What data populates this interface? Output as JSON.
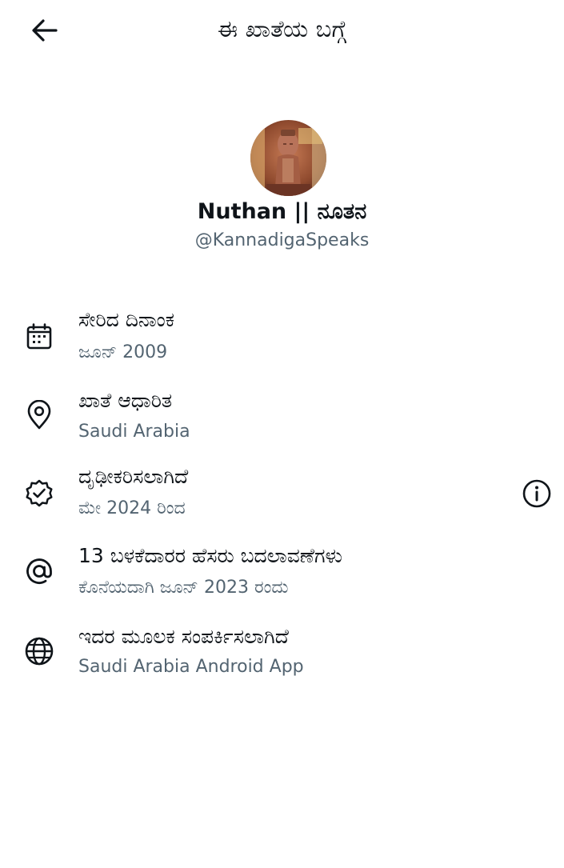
{
  "header": {
    "back_icon": "arrow-left-icon",
    "title": "ಈ ಖಾತೆಯ ಬಗ್ಗೆ"
  },
  "profile": {
    "avatar_icon": "avatar",
    "display_name": "Nuthan || ನೂತನ",
    "handle": "@KannadigaSpeaks"
  },
  "rows": [
    {
      "icon": "calendar-icon",
      "title": "ಸೇರಿದ ದಿನಾಂಕ",
      "subtitle": "ಜೂನ್ 2009"
    },
    {
      "icon": "location-pin-icon",
      "title": "ಖಾತೆ ಆಧಾರಿತ",
      "subtitle": "Saudi Arabia"
    },
    {
      "icon": "verified-badge-icon",
      "title": "ದೃಢೀಕರಿಸಲಾಗಿದೆ",
      "subtitle": "ಮೇ 2024 ರಿಂದ",
      "action_icon": "info-icon"
    },
    {
      "icon": "at-sign-icon",
      "title": "13 ಬಳಕೆದಾರರ ಹೆಸರು ಬದಲಾವಣೆಗಳು",
      "subtitle": "ಕೊನೆಯದಾಗಿ ಜೂನ್ 2023 ರಂದು"
    },
    {
      "icon": "globe-icon",
      "title": "ಇದರ ಮೂಲಕ ಸಂಪರ್ಕಿಸಲಾಗಿದೆ",
      "subtitle": "Saudi Arabia Android App"
    }
  ],
  "colors": {
    "text_primary": "#0f1419",
    "text_secondary": "#536471",
    "icon": "#0f1419",
    "background": "#ffffff"
  }
}
